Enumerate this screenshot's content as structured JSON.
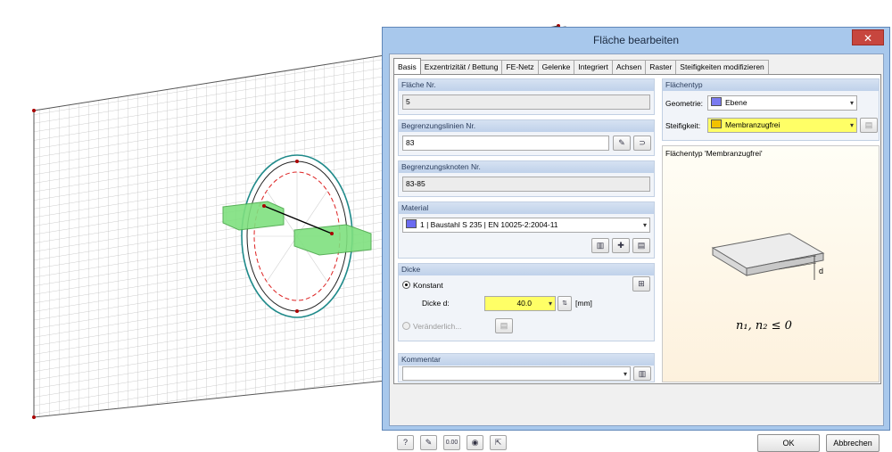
{
  "dialog": {
    "title": "Fläche bearbeiten",
    "close_glyph": "✕",
    "tabs": [
      "Basis",
      "Exzentrizität / Bettung",
      "FE-Netz",
      "Gelenke",
      "Integriert",
      "Achsen",
      "Raster",
      "Steifigkeiten modifizieren"
    ],
    "active_tab": "Basis"
  },
  "left": {
    "flaeche_nr": {
      "label": "Fläche Nr.",
      "value": "5"
    },
    "begrenzungslinien": {
      "label": "Begrenzungslinien Nr.",
      "value": "83"
    },
    "begrenzungsknoten": {
      "label": "Begrenzungsknoten Nr.",
      "value": "83-85"
    },
    "material": {
      "label": "Material",
      "value": "1  |  Baustahl S 235  |  EN 10025-2:2004-11",
      "color": "#6b6bf0"
    },
    "dicke": {
      "label": "Dicke",
      "konstant_label": "Konstant",
      "dicke_d_label": "Dicke d:",
      "dicke_d_value": "40.0",
      "unit": "[mm]",
      "veraenderlich_label": "Veränderlich..."
    },
    "kommentar": {
      "label": "Kommentar",
      "value": ""
    }
  },
  "right": {
    "flaechentyp_label": "Flächentyp",
    "geometrie_label": "Geometrie:",
    "geometrie_value": "Ebene",
    "geometrie_color": "#7b7bf0",
    "steifigkeit_label": "Steifigkeit:",
    "steifigkeit_value": "Membranzugfrei",
    "steifigkeit_color": "#f2c200",
    "highlight_color": "#ffff66",
    "preview_caption": "Flächentyp 'Membranzugfrei'",
    "formula": "n₁, n₂ ≤ 0",
    "dim_label": "d"
  },
  "buttons": {
    "ok": "OK",
    "cancel": "Abbrechen",
    "units_icon_text": "0.00"
  }
}
